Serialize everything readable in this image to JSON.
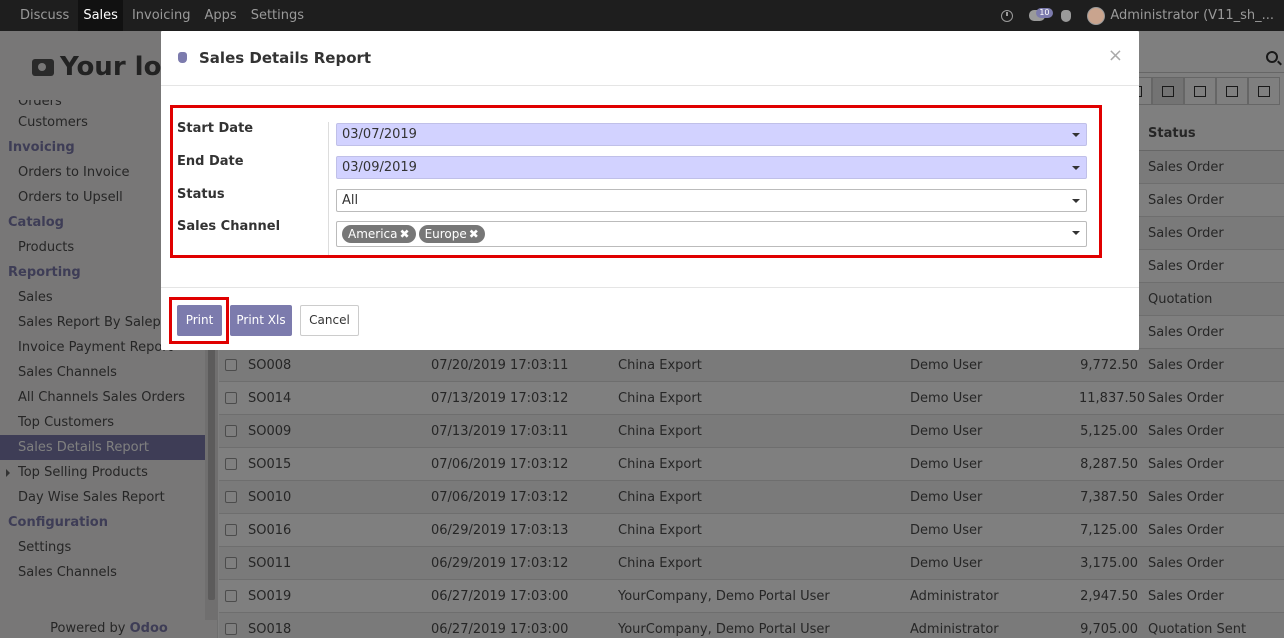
{
  "navbar": {
    "menu": [
      "Discuss",
      "Sales",
      "Invoicing",
      "Apps",
      "Settings"
    ],
    "active": "Sales",
    "chat_count": "10",
    "user": "Administrator (V11_sh_..."
  },
  "sidebar": {
    "logo": "Your log",
    "items": [
      {
        "type": "item",
        "label": "Orders"
      },
      {
        "type": "item",
        "label": "Customers"
      },
      {
        "type": "group",
        "label": "Invoicing"
      },
      {
        "type": "item",
        "label": "Orders to Invoice"
      },
      {
        "type": "item",
        "label": "Orders to Upsell"
      },
      {
        "type": "group",
        "label": "Catalog"
      },
      {
        "type": "item",
        "label": "Products"
      },
      {
        "type": "group",
        "label": "Reporting"
      },
      {
        "type": "item",
        "label": "Sales"
      },
      {
        "type": "item",
        "label": "Sales Report By Salepe..."
      },
      {
        "type": "item",
        "label": "Invoice Payment Report"
      },
      {
        "type": "item",
        "label": "Sales Channels"
      },
      {
        "type": "item",
        "label": "All Channels Sales Orders"
      },
      {
        "type": "item",
        "label": "Top Customers"
      },
      {
        "type": "item",
        "label": "Sales Details Report",
        "active": true
      },
      {
        "type": "item",
        "label": "Top Selling Products",
        "caret": true
      },
      {
        "type": "item",
        "label": "Day Wise Sales Report"
      },
      {
        "type": "group",
        "label": "Configuration"
      },
      {
        "type": "item",
        "label": "Settings"
      },
      {
        "type": "item",
        "label": "Sales Channels"
      }
    ],
    "powered_prefix": "Powered by",
    "powered_brand": "Odoo"
  },
  "list": {
    "status_header": "Status",
    "rows": [
      {
        "number": "",
        "date": "",
        "customer": "",
        "salesperson": "",
        "total": "",
        "status": "Sales Order"
      },
      {
        "number": "",
        "date": "",
        "customer": "",
        "salesperson": "",
        "total": "",
        "status": "Sales Order"
      },
      {
        "number": "",
        "date": "",
        "customer": "",
        "salesperson": "",
        "total": "",
        "status": "Sales Order"
      },
      {
        "number": "",
        "date": "",
        "customer": "",
        "salesperson": "",
        "total": "",
        "status": "Sales Order"
      },
      {
        "number": "",
        "date": "",
        "customer": "",
        "salesperson": "",
        "total": "",
        "status": "Quotation"
      },
      {
        "number": "",
        "date": "",
        "customer": "",
        "salesperson": "",
        "total": "",
        "status": "Sales Order"
      },
      {
        "number": "SO008",
        "date": "07/20/2019 17:03:11",
        "customer": "China Export",
        "salesperson": "Demo User",
        "total": "9,772.50",
        "status": "Sales Order"
      },
      {
        "number": "SO014",
        "date": "07/13/2019 17:03:12",
        "customer": "China Export",
        "salesperson": "Demo User",
        "total": "11,837.50",
        "status": "Sales Order"
      },
      {
        "number": "SO009",
        "date": "07/13/2019 17:03:11",
        "customer": "China Export",
        "salesperson": "Demo User",
        "total": "5,125.00",
        "status": "Sales Order"
      },
      {
        "number": "SO015",
        "date": "07/06/2019 17:03:12",
        "customer": "China Export",
        "salesperson": "Demo User",
        "total": "8,287.50",
        "status": "Sales Order"
      },
      {
        "number": "SO010",
        "date": "07/06/2019 17:03:12",
        "customer": "China Export",
        "salesperson": "Demo User",
        "total": "7,387.50",
        "status": "Sales Order"
      },
      {
        "number": "SO016",
        "date": "06/29/2019 17:03:13",
        "customer": "China Export",
        "salesperson": "Demo User",
        "total": "7,125.00",
        "status": "Sales Order"
      },
      {
        "number": "SO011",
        "date": "06/29/2019 17:03:12",
        "customer": "China Export",
        "salesperson": "Demo User",
        "total": "3,175.00",
        "status": "Sales Order"
      },
      {
        "number": "SO019",
        "date": "06/27/2019 17:03:00",
        "customer": "YourCompany, Demo Portal User",
        "salesperson": "Administrator",
        "total": "2,947.50",
        "status": "Sales Order"
      },
      {
        "number": "SO018",
        "date": "06/27/2019 17:03:00",
        "customer": "YourCompany, Demo Portal User",
        "salesperson": "Administrator",
        "total": "9,705.00",
        "status": "Quotation Sent"
      }
    ]
  },
  "modal": {
    "title": "Sales Details Report",
    "close": "×",
    "fields": {
      "start_date_label": "Start Date",
      "start_date_value": "03/07/2019",
      "end_date_label": "End Date",
      "end_date_value": "03/09/2019",
      "status_label": "Status",
      "status_value": "All",
      "channel_label": "Sales Channel",
      "channel_tags": [
        "America",
        "Europe"
      ]
    },
    "buttons": {
      "print": "Print",
      "print_xls": "Print Xls",
      "cancel": "Cancel"
    }
  },
  "colors": {
    "brand": "#7c7bad",
    "highlight": "#e00000",
    "date_field": "#d2d2ff"
  }
}
